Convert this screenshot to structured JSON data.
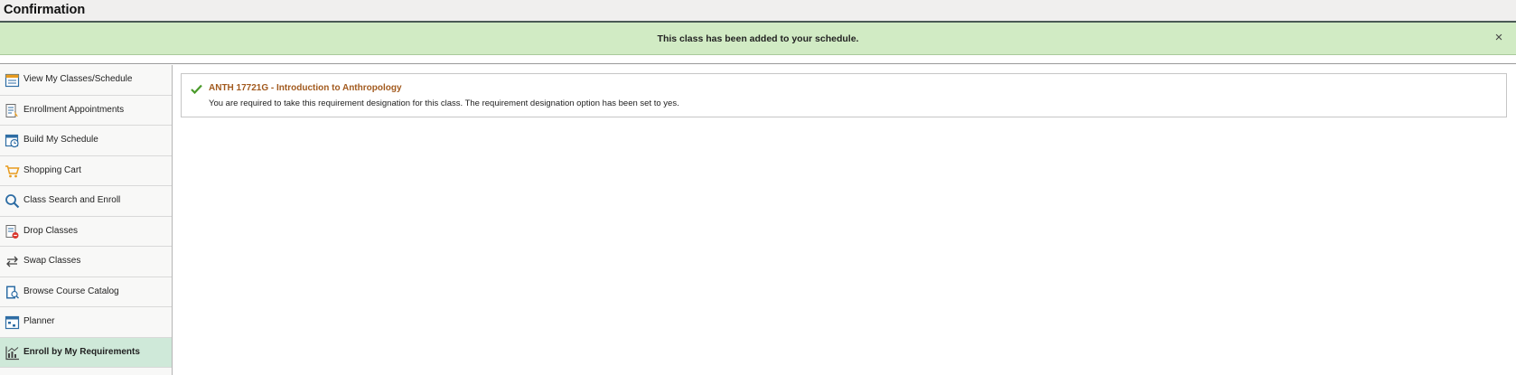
{
  "page": {
    "title": "Confirmation"
  },
  "banner": {
    "message": "This class has been added to your schedule.",
    "close_glyph": "×"
  },
  "sidebar": {
    "items": [
      {
        "label": "View My Classes/Schedule",
        "icon": "calendar-icon"
      },
      {
        "label": "Enrollment Appointments",
        "icon": "appointment-icon"
      },
      {
        "label": "Build My Schedule",
        "icon": "schedule-clock-icon"
      },
      {
        "label": "Shopping Cart",
        "icon": "shopping-cart-icon"
      },
      {
        "label": "Class Search and Enroll",
        "icon": "search-icon"
      },
      {
        "label": "Drop Classes",
        "icon": "drop-classes-icon"
      },
      {
        "label": "Swap Classes",
        "icon": "swap-icon"
      },
      {
        "label": "Browse Course Catalog",
        "icon": "catalog-icon"
      },
      {
        "label": "Planner",
        "icon": "planner-icon"
      },
      {
        "label": "Enroll by My Requirements",
        "icon": "chart-icon",
        "active": true
      }
    ]
  },
  "result": {
    "status": "success",
    "class_title": "ANTH 17721G - Introduction to Anthropology",
    "message": "You are required to take this requirement designation for this class. The requirement designation option has been set to yes."
  },
  "colors": {
    "banner_bg": "#d1ebc4",
    "active_item_bg": "#cfe9d9",
    "class_title": "#a25a1e",
    "check": "#4a9a2a",
    "icon_blue": "#2e6da4",
    "cart_orange": "#e89b1f"
  }
}
